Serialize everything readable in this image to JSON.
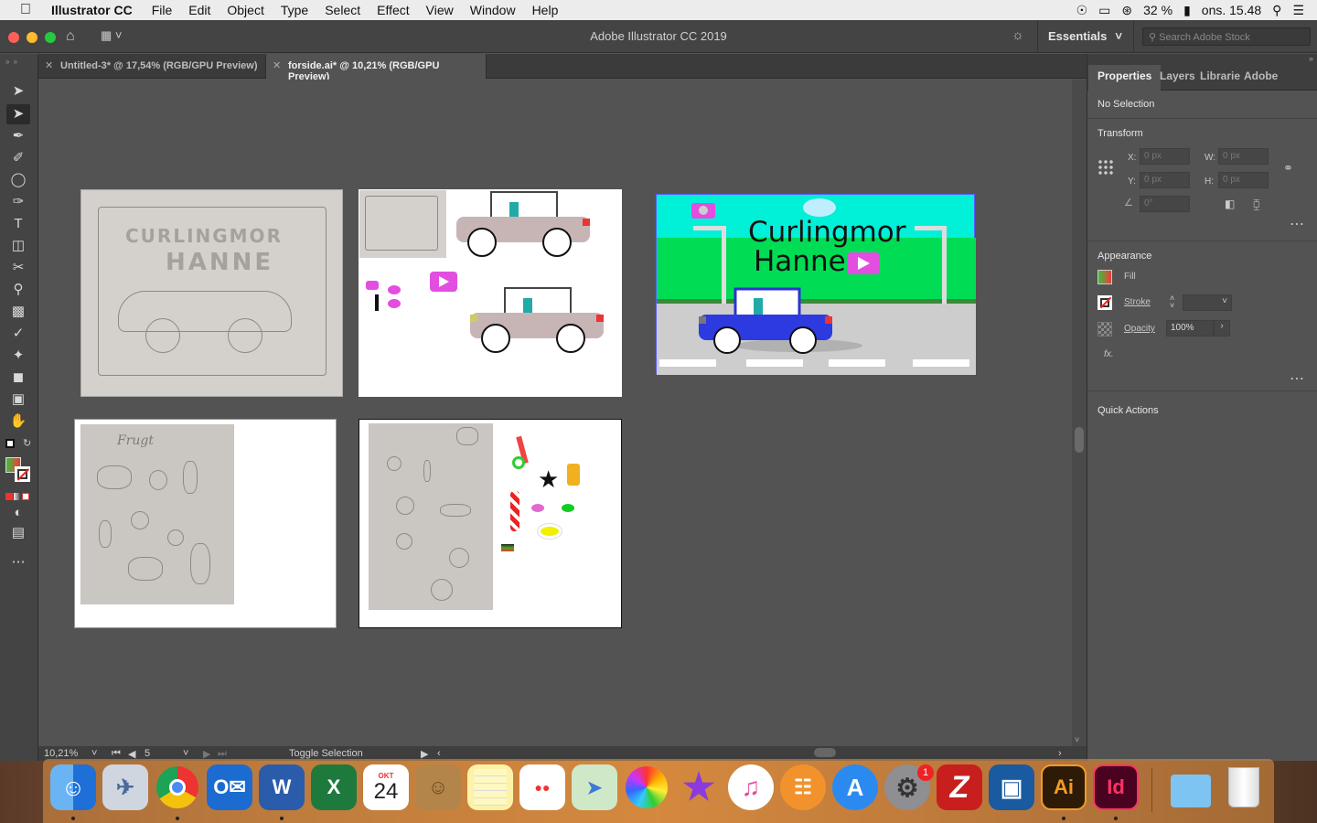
{
  "menubar": {
    "app_name": "Illustrator CC",
    "items": [
      "File",
      "Edit",
      "Object",
      "Type",
      "Select",
      "Effect",
      "View",
      "Window",
      "Help"
    ],
    "battery": "32 %",
    "clock": "ons. 15.48"
  },
  "window": {
    "title": "Adobe Illustrator CC 2019",
    "workspace": "Essentials",
    "stock_search_placeholder": "Search Adobe Stock"
  },
  "tabs": [
    {
      "label": "Untitled-3* @ 17,54% (RGB/GPU Preview)",
      "active": false
    },
    {
      "label": "forside.ai* @ 10,21% (RGB/GPU Preview)",
      "active": true
    }
  ],
  "artwork": {
    "title_line1": "Curlingmor",
    "title_line2": "Hanne",
    "sketch_caption": "Frugt"
  },
  "statusbar": {
    "zoom": "10,21%",
    "artboard": "5",
    "status": "Toggle Selection"
  },
  "panel": {
    "tabs": [
      "Properties",
      "Layers",
      "Librarie",
      "Adobe C"
    ],
    "selection": "No Selection",
    "transform": {
      "title": "Transform",
      "x_label": "X:",
      "x_placeholder": "0 px",
      "y_label": "Y:",
      "y_placeholder": "0 px",
      "w_label": "W:",
      "w_placeholder": "0 px",
      "h_label": "H:",
      "h_placeholder": "0 px",
      "angle_placeholder": "0°"
    },
    "appearance": {
      "title": "Appearance",
      "fill_label": "Fill",
      "stroke_label": "Stroke",
      "opacity_label": "Opacity",
      "opacity_value": "100%",
      "fx_label": "fx."
    },
    "quick_actions": "Quick Actions"
  },
  "dock": {
    "calendar_month": "OKT",
    "calendar_day": "24",
    "settings_badge": "1",
    "illustrator": "Ai",
    "indesign": "Id"
  }
}
